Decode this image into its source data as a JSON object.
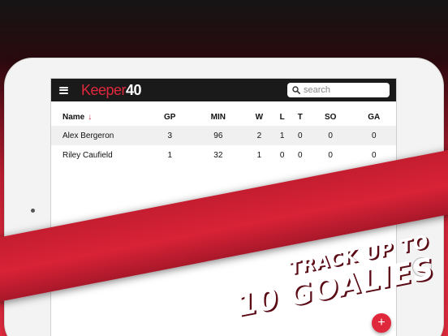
{
  "app": {
    "logo_part1": "Keeper",
    "logo_part2": "40"
  },
  "search": {
    "placeholder": "search",
    "value": ""
  },
  "table": {
    "columns": [
      "Name",
      "GP",
      "MIN",
      "W",
      "L",
      "T",
      "SO",
      "GA"
    ],
    "sort_indicator": "↓",
    "rows": [
      [
        "Alex Bergeron",
        "3",
        "96",
        "2",
        "1",
        "0",
        "0",
        "0"
      ],
      [
        "Riley Caufield",
        "1",
        "32",
        "1",
        "0",
        "0",
        "0",
        "0"
      ]
    ]
  },
  "banner": {
    "line1": "TRACK UP TO",
    "line2": "10 GOALIES"
  },
  "fab": {
    "label": "+"
  },
  "colors": {
    "accent": "#e0283c",
    "topbar": "#1a1a1a"
  },
  "icons": [
    "menu-icon",
    "search-icon",
    "sort-down-icon",
    "add-icon"
  ]
}
